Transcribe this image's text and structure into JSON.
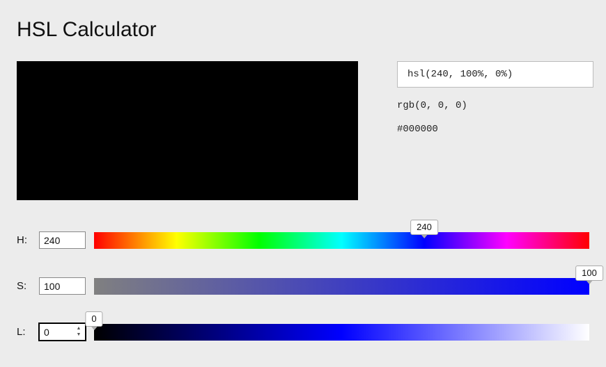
{
  "title": "HSL Calculator",
  "swatch_color": "#000000",
  "output": {
    "hsl": "hsl(240, 100%, 0%)",
    "rgb": "rgb(0, 0, 0)",
    "hex": "#000000"
  },
  "h": {
    "label": "H:",
    "value": "240",
    "thumb": "240",
    "max": 360
  },
  "s": {
    "label": "S:",
    "value": "100",
    "thumb": "100",
    "max": 100
  },
  "l": {
    "label": "L:",
    "value": "0",
    "thumb": "0",
    "max": 100
  }
}
